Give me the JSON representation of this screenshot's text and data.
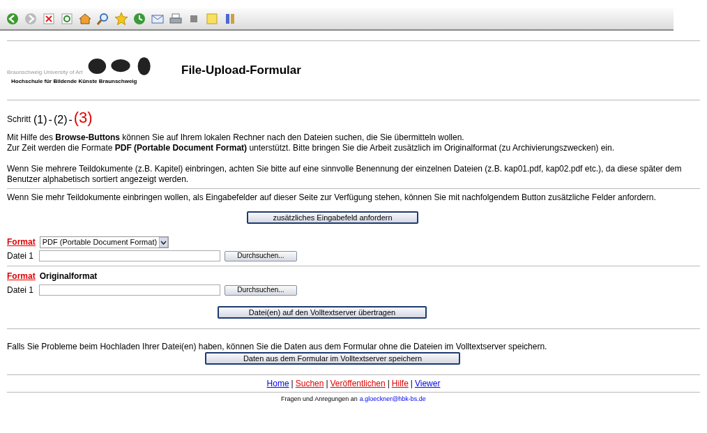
{
  "logo": {
    "caption": "Braunschweig University of Art",
    "name": "Hochschule für Bildende Künste Braunschweig"
  },
  "title": "File-Upload-Formular",
  "steps": {
    "label": "Schritt",
    "items": [
      {
        "text": "(1)",
        "selected": false
      },
      {
        "text": "-",
        "selected": false
      },
      {
        "text": "(2)",
        "selected": false
      },
      {
        "text": "-",
        "selected": false
      },
      {
        "text": "(3)",
        "selected": true
      }
    ]
  },
  "intro": [
    "Mit Hilfe des **Browse-Buttons** können Sie auf Ihrem lokalen Rechner nach den Dateien suchen, die Sie übermitteln wollen.",
    "Zur Zeit werden die Formate **PDF (Portable Document Format)** unterstützt. Bitte bringen Sie die Arbeit zusätzlich im Originalformat (zu Archivierungszwecken) ein."
  ],
  "naming_note": "Wenn Sie mehrere Teildokumente (z.B. Kapitel) einbringen, achten Sie bitte auf eine sinnvolle Benennung der einzelnen Dateien (z.B. kap01.pdf, kap02.pdf etc.), da diese später dem Benutzer alphabetisch sortiert angezeigt werden.",
  "more_note": "Wenn Sie mehr Teildokumente einbringen wollen, als Eingabefelder auf dieser Seite zur Verfügung stehen, können Sie mit nachfolgendem Button zusätzliche Felder anfordern.",
  "add_field_button": "zusätzliches Eingabefeld anfordern",
  "sections": [
    {
      "kind": "select",
      "format_label": "Format",
      "format_value": "PDF (Portable Document Format)",
      "file_label": "Datei 1",
      "browse_button": "Durchsuchen..."
    },
    {
      "kind": "fixed",
      "format_label": "Format",
      "format_value": "Originalformat",
      "file_label": "Datei 1",
      "browse_button": "Durchsuchen..."
    }
  ],
  "upload_button": "Datei(en) auf den Volltextserver übertragen",
  "problem_note": "Falls Sie Probleme beim Hochladen Ihrer Datei(en) haben, können Sie die Daten aus dem Formular ohne die Dateien im Volltextserver speichern.",
  "save_button": "Daten aus dem Formular im Volltextserver speichern",
  "nav": [
    {
      "text": "Home",
      "color": "#0000ee"
    },
    {
      "text": "Suchen",
      "color": "#e00000"
    },
    {
      "text": "Veröffentlichen",
      "color": "#e00000"
    },
    {
      "text": "Hilfe",
      "color": "#e00000"
    },
    {
      "text": "Viewer",
      "color": "#0000ee"
    }
  ],
  "nav_separator": "|",
  "contact": {
    "text": "Fragen und Anregungen an",
    "link": "a.gloeckner@hbk-bs.de"
  }
}
